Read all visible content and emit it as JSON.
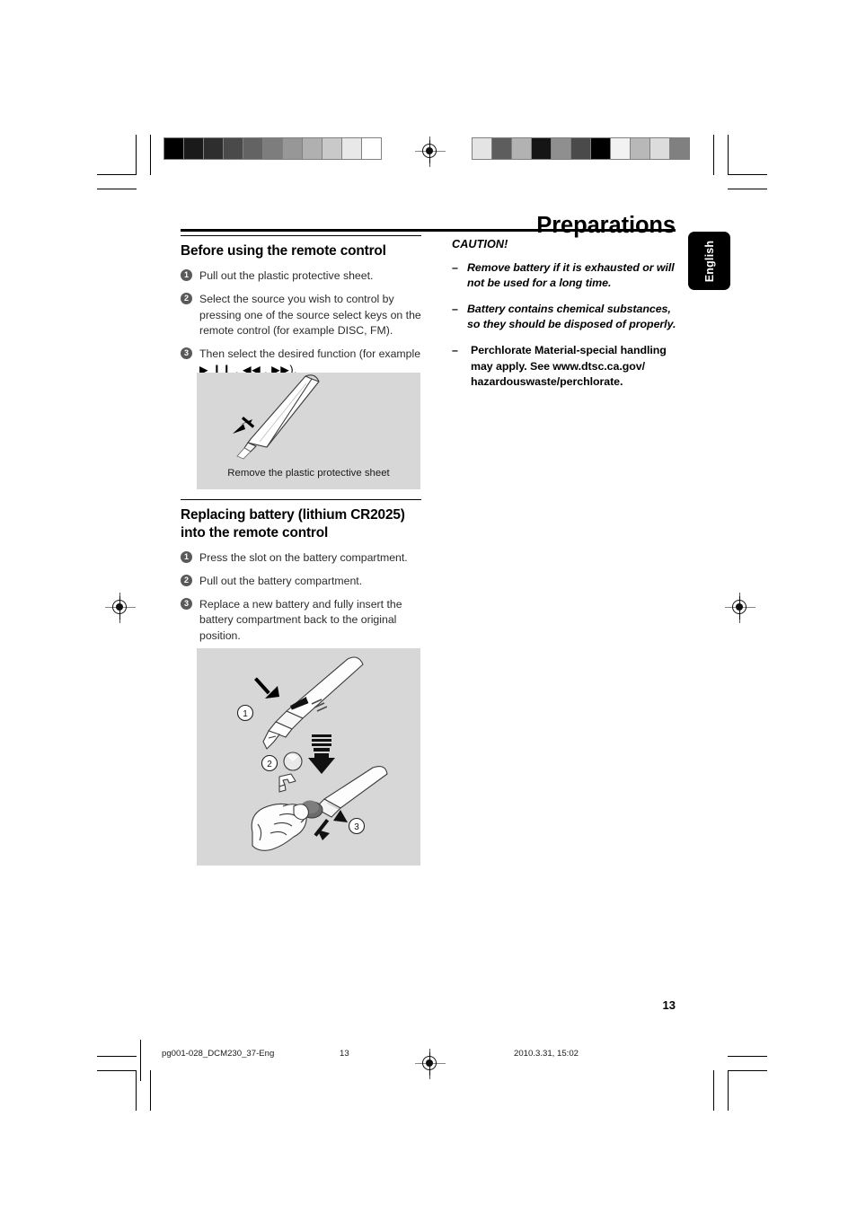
{
  "header": {
    "title": "Preparations",
    "language_tab": "English"
  },
  "left_column": {
    "section1": {
      "heading": "Before using the remote control",
      "steps": [
        {
          "num": "1",
          "text": "Pull out the plastic protective sheet."
        },
        {
          "num": "2",
          "text": "Select the source you wish to control by pressing one of the source select keys on the remote control (for example DISC, FM)."
        },
        {
          "num": "3",
          "text": "Then select the desired function (for example",
          "media_keys": "▶ ❙❙ ,  ◀◀ , ▶▶)."
        }
      ],
      "figure": {
        "caption": "Remove the plastic protective sheet",
        "name": "remote-protective-sheet-illustration"
      }
    },
    "section2": {
      "heading": "Replacing battery (lithium CR2025) into the remote control",
      "steps": [
        {
          "num": "1",
          "text": "Press the slot on the battery compartment."
        },
        {
          "num": "2",
          "text": "Pull out the battery compartment."
        },
        {
          "num": "3",
          "text": "Replace a new battery and fully insert the battery compartment back to the original position."
        }
      ],
      "figure": {
        "name": "battery-replacement-illustration",
        "callouts": [
          "1",
          "2",
          "3"
        ]
      }
    }
  },
  "right_column": {
    "caution_title": "CAUTION!",
    "caution_items": [
      {
        "dash": "–",
        "text": "Remove battery if it is exhausted or will not be used for a long time.",
        "style": "italic"
      },
      {
        "dash": "–",
        "text": "Battery contains chemical substances, so they should be disposed of properly.",
        "style": "italic"
      },
      {
        "dash": "–",
        "text": "Perchlorate Material-special handling may apply. See www.dtsc.ca.gov/ hazardouswaste/perchlorate.",
        "style": "upright"
      }
    ]
  },
  "page_number": "13",
  "footer": {
    "file": "pg001-028_DCM230_37-Eng",
    "page": "13",
    "date": "2010.3.31, 15:02"
  },
  "calibration": {
    "left_swatches": [
      "#000000",
      "#1a1a1a",
      "#2e2e2e",
      "#4a4a4a",
      "#636363",
      "#7d7d7d",
      "#979797",
      "#b0b0b0",
      "#c9c9c9",
      "#e8e8e8",
      "#ffffff"
    ],
    "right_swatches": [
      "#e4e4e4",
      "#5d5d5d",
      "#b2b2b2",
      "#151515",
      "#8f8f8f",
      "#4a4a4a",
      "#000000",
      "#f2f2f2",
      "#b8b8b8",
      "#dcdcdc",
      "#808080"
    ]
  },
  "colors": {
    "illustration_background": "#d7d7d7",
    "step_bullet": "#58595b",
    "tab_background": "#000000"
  }
}
